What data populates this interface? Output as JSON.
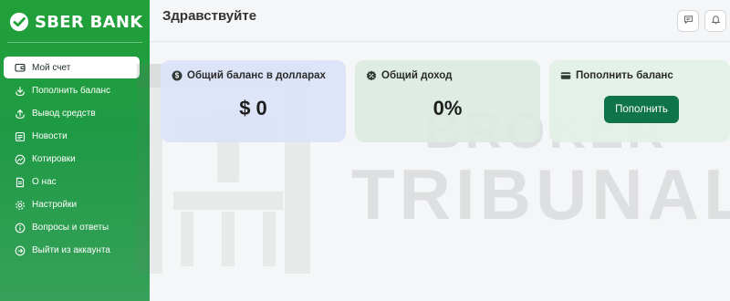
{
  "brand": {
    "name": "SBER BANK",
    "logo_icon": "sber-logo-icon",
    "logo_color": "#21a038"
  },
  "sidebar": {
    "items": [
      {
        "label": "Мой счет",
        "icon": "wallet-icon",
        "active": true
      },
      {
        "label": "Пополнить баланс",
        "icon": "download-icon"
      },
      {
        "label": "Вывод средств",
        "icon": "upload-icon"
      },
      {
        "label": "Новости",
        "icon": "newspaper-icon"
      },
      {
        "label": "Котировки",
        "icon": "chart-circle-icon"
      },
      {
        "label": "О нас",
        "icon": "document-icon"
      },
      {
        "label": "Настройки",
        "icon": "gear-icon"
      },
      {
        "label": "Вопросы и ответы",
        "icon": "info-icon"
      },
      {
        "label": "Выйти из аккаунта",
        "icon": "logout-icon"
      }
    ]
  },
  "header": {
    "title": "Здравствуйте",
    "buttons": [
      {
        "icon": "chat-icon"
      },
      {
        "icon": "bell-icon"
      }
    ]
  },
  "cards": {
    "balance": {
      "title": "Общий баланс в долларах",
      "value": "$ 0",
      "icon": "dollar-icon",
      "bg": "#dbe3f7"
    },
    "income": {
      "title": "Общий доход",
      "value": "0%",
      "icon": "percent-badge-icon",
      "bg": "#dceae2"
    },
    "topup": {
      "title": "Пополнить баланс",
      "button_label": "Пополнить",
      "icon": "card-icon",
      "button_color": "#10744a"
    }
  },
  "watermark": {
    "line1": "BROKER",
    "line2": "TRIBUNAL"
  },
  "colors": {
    "sidebar_green": "#21a038",
    "accent": "#10744a",
    "page_bg": "#f5f6f7"
  }
}
